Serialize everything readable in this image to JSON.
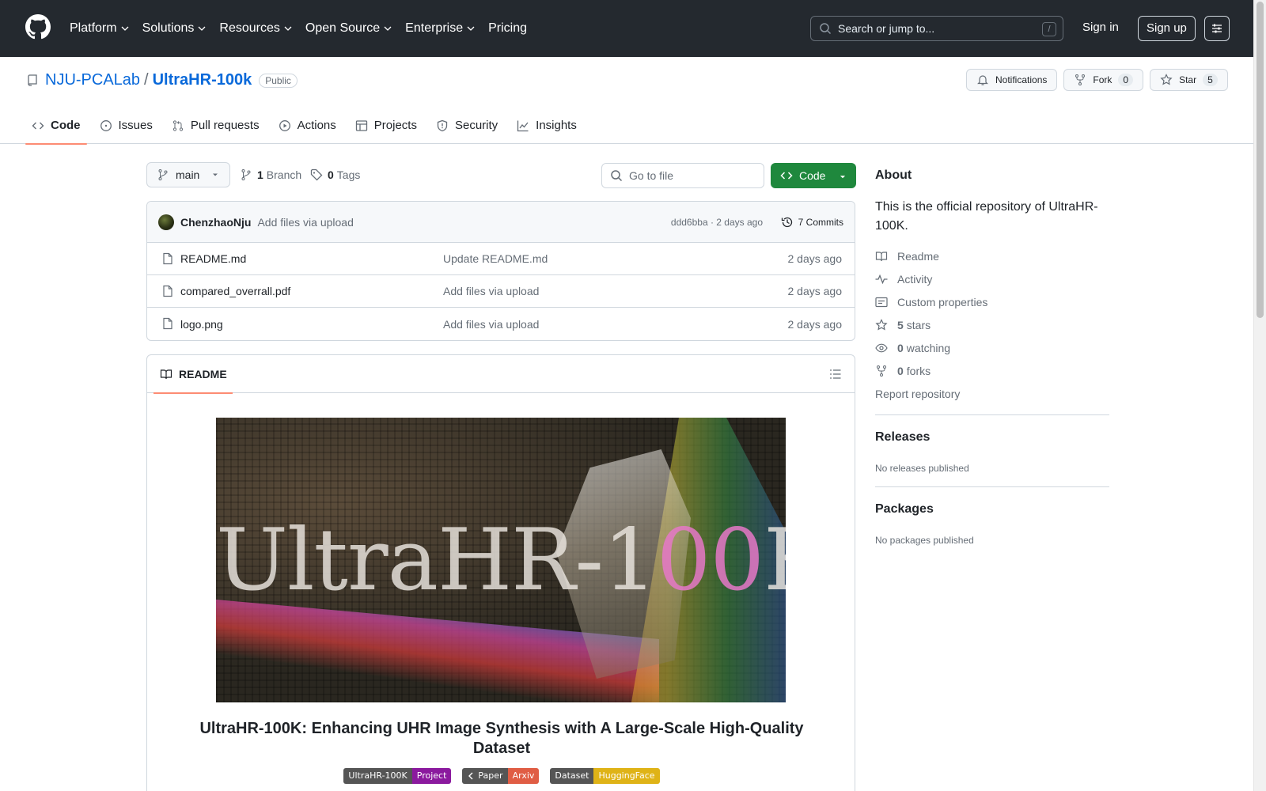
{
  "nav": {
    "items": [
      {
        "label": "Platform"
      },
      {
        "label": "Solutions"
      },
      {
        "label": "Resources"
      },
      {
        "label": "Open Source"
      },
      {
        "label": "Enterprise"
      },
      {
        "label": "Pricing"
      }
    ],
    "search_placeholder": "Search or jump to...",
    "search_shortcut": "/",
    "sign_in": "Sign in",
    "sign_up": "Sign up"
  },
  "repo": {
    "owner": "NJU-PCALab",
    "separator": "/",
    "name": "UltraHR-100k",
    "visibility": "Public",
    "notifications_label": "Notifications",
    "fork_label": "Fork",
    "fork_count": "0",
    "star_label": "Star",
    "star_count": "5"
  },
  "tabs": [
    {
      "label": "Code",
      "icon": "code-icon",
      "active": true
    },
    {
      "label": "Issues",
      "icon": "issue-icon"
    },
    {
      "label": "Pull requests",
      "icon": "pull-request-icon"
    },
    {
      "label": "Actions",
      "icon": "play-icon"
    },
    {
      "label": "Projects",
      "icon": "table-icon"
    },
    {
      "label": "Security",
      "icon": "shield-icon"
    },
    {
      "label": "Insights",
      "icon": "graph-icon"
    }
  ],
  "toolbar": {
    "branch": "main",
    "branch_count": "1",
    "branch_label": "Branch",
    "tag_count": "0",
    "tag_label": "Tags",
    "go_to_file": "Go to file",
    "code_button": "Code"
  },
  "latest_commit": {
    "author": "ChenzhaoNju",
    "message": "Add files via upload",
    "sha_age": "ddd6bba · 2 days ago",
    "commits": "7 Commits"
  },
  "files": [
    {
      "name": "README.md",
      "message": "Update README.md",
      "age": "2 days ago"
    },
    {
      "name": "compared_overrall.pdf",
      "message": "Add files via upload",
      "age": "2 days ago"
    },
    {
      "name": "logo.png",
      "message": "Add files via upload",
      "age": "2 days ago"
    }
  ],
  "readme": {
    "tab_label": "README",
    "banner_word_main": "UltraHR-1",
    "banner_word_accent": "00",
    "banner_word_end": "K",
    "title": "UltraHR-100K: Enhancing UHR Image Synthesis with A Large-Scale High-Quality Dataset",
    "badges": [
      {
        "left": "UltraHR-100K",
        "right": "Project",
        "color": "#8b1a9e"
      },
      {
        "left": "Paper",
        "right": "Arxiv",
        "color": "#e05d44",
        "icon": "chevron-left-icon"
      },
      {
        "left": "Dataset",
        "right": "HuggingFace",
        "color": "#dfb317"
      }
    ]
  },
  "about": {
    "heading": "About",
    "description": "This is the official repository of UltraHR-100K.",
    "links": [
      {
        "icon": "book-icon",
        "label": "Readme"
      },
      {
        "icon": "pulse-icon",
        "label": "Activity"
      },
      {
        "icon": "note-icon",
        "label": "Custom properties"
      },
      {
        "icon": "star-icon",
        "count": "5",
        "label": "stars"
      },
      {
        "icon": "eye-icon",
        "count": "0",
        "label": "watching"
      },
      {
        "icon": "fork-icon",
        "count": "0",
        "label": "forks"
      }
    ],
    "report": "Report repository"
  },
  "releases": {
    "heading": "Releases",
    "text": "No releases published"
  },
  "packages": {
    "heading": "Packages",
    "text": "No packages published"
  },
  "colors": {
    "header_bg": "#24292f",
    "link": "#0969da",
    "primary_button": "#1f883d",
    "tab_underline": "#fd8c73"
  }
}
